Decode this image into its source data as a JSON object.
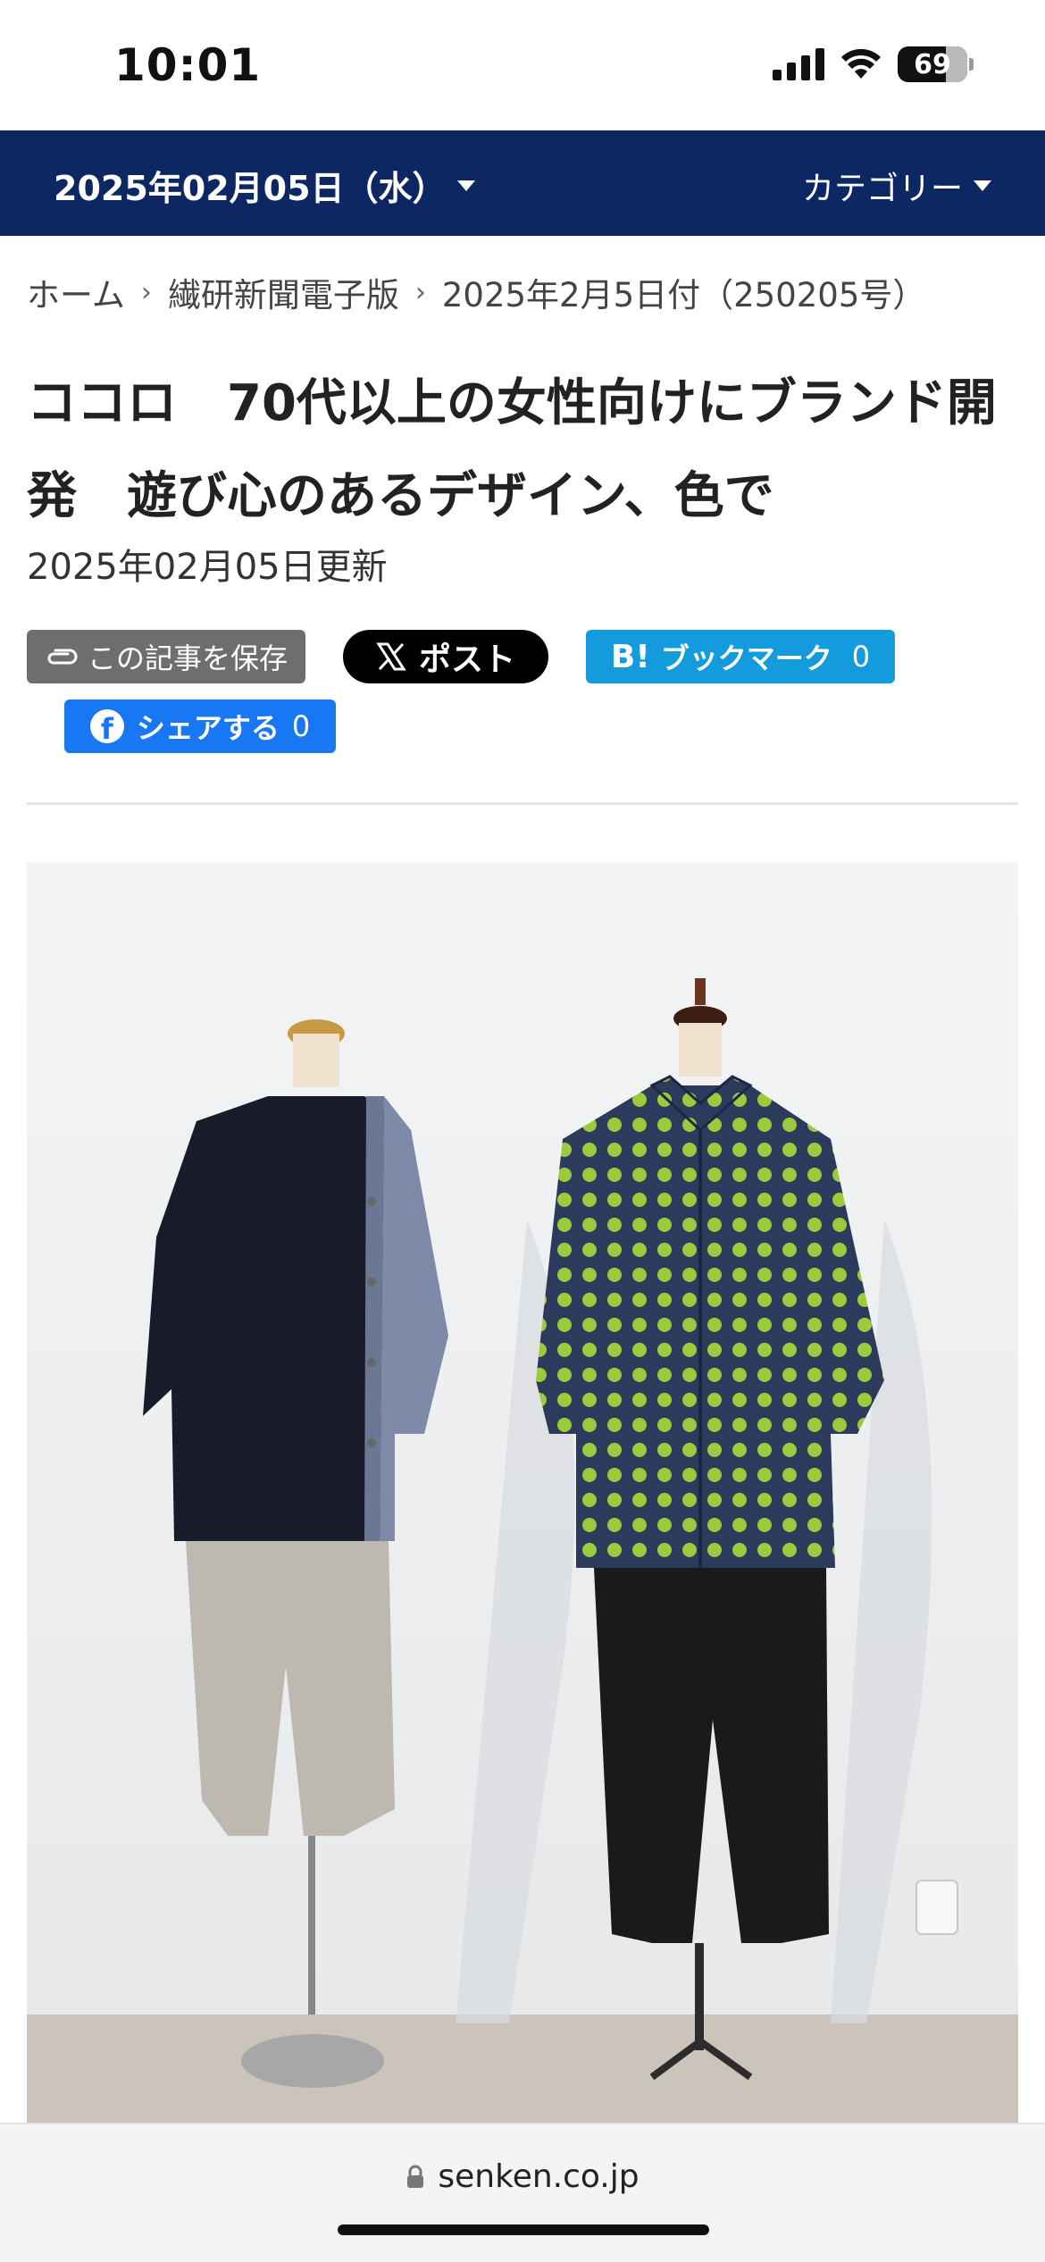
{
  "status_bar": {
    "time": "10:01",
    "battery": "69"
  },
  "nav": {
    "date_label": "2025年02月05日（水）",
    "category_label": "カテゴリー"
  },
  "breadcrumb": {
    "items": [
      "ホーム",
      "繊研新聞電子版",
      "2025年2月5日付（250205号）"
    ]
  },
  "article": {
    "title": "ココロ　70代以上の女性向けにブランド開発　遊び心のあるデザイン、色で",
    "updated": "2025年02月05日更新"
  },
  "share": {
    "save_label": "この記事を保存",
    "post_label": "ポスト",
    "hatena_mark": "B!",
    "hatena_label": "ブックマーク",
    "hatena_count": "0",
    "facebook_label": "シェアする",
    "facebook_count": "0"
  },
  "browser": {
    "url": "senken.co.jp"
  },
  "colors": {
    "nav_bg": "#0d2762",
    "hatena": "#139bdb",
    "facebook": "#1877f2",
    "save": "#6e6e6e"
  },
  "icons": [
    "signal-icon",
    "wifi-icon",
    "battery-icon",
    "caret-down-icon",
    "chevron-right-icon",
    "paperclip-icon",
    "x-logo-icon",
    "facebook-icon",
    "lock-icon"
  ]
}
